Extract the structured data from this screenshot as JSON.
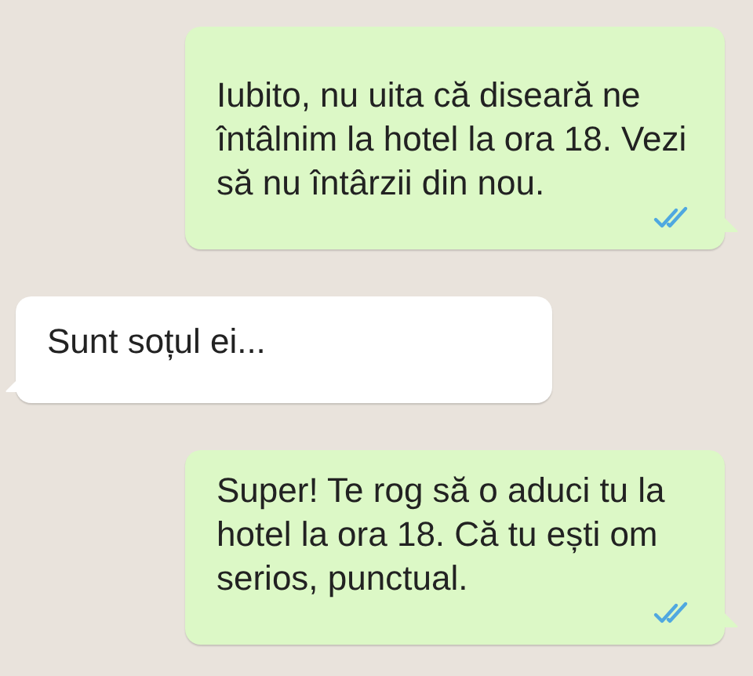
{
  "messages": [
    {
      "kind": "outgoing",
      "text": "Iubito, nu uita că diseară ne întâlnim la hotel la ora 18. Vezi să nu întârzii din nou.",
      "read": true
    },
    {
      "kind": "incoming",
      "text": "Sunt soțul ei..."
    },
    {
      "kind": "outgoing",
      "text": "Super! Te rog să o aduci tu la hotel la ora 18. Că tu ești om serios, punctual.",
      "read": true
    }
  ]
}
